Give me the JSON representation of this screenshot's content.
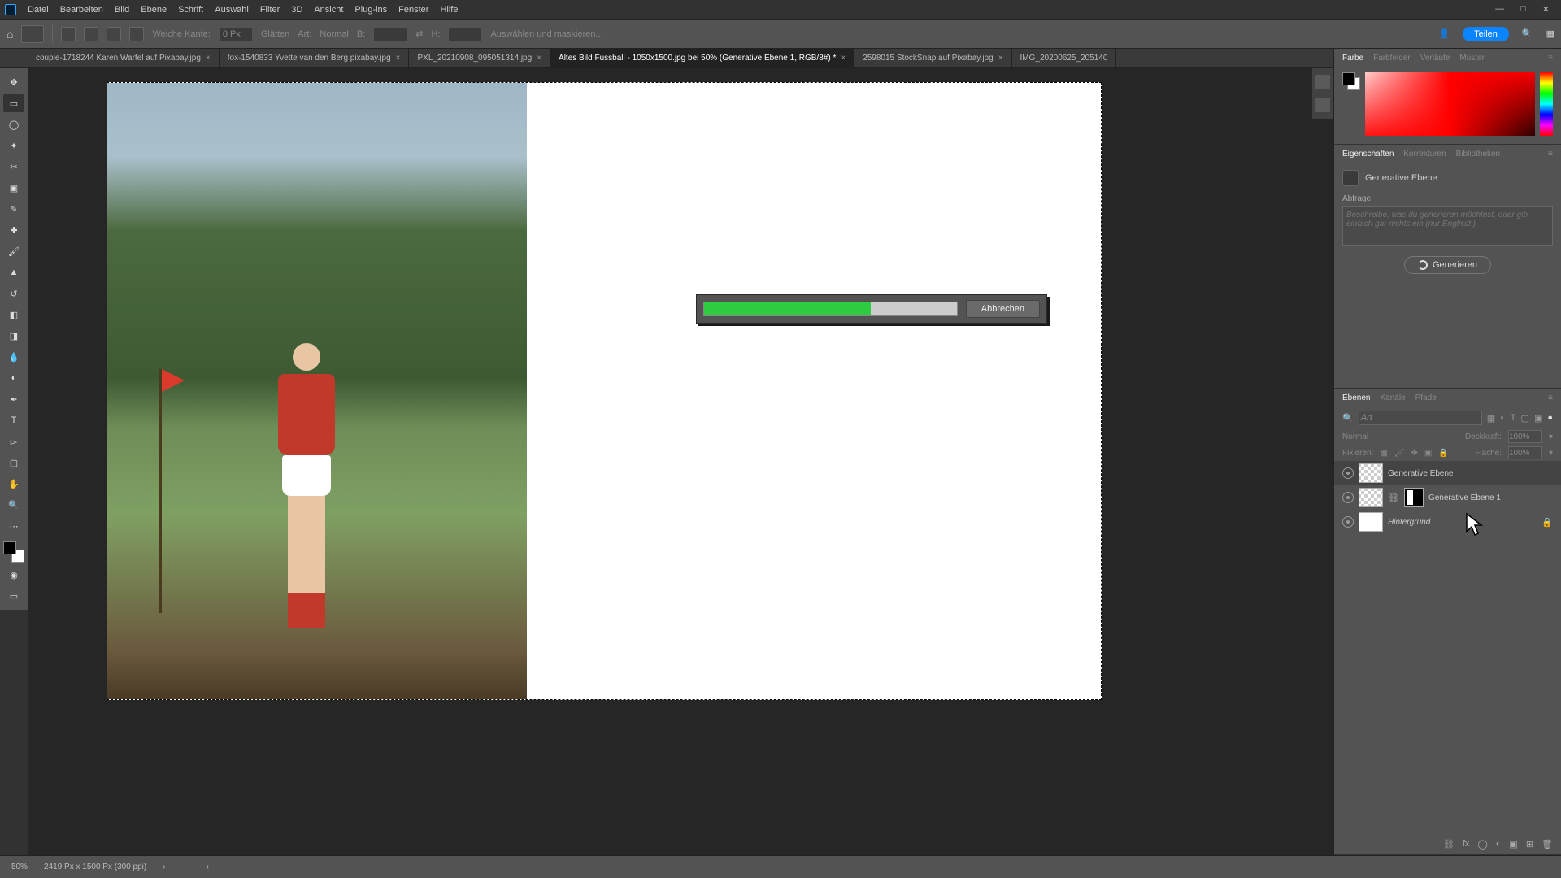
{
  "menubar": {
    "items": [
      "Datei",
      "Bearbeiten",
      "Bild",
      "Ebene",
      "Schrift",
      "Auswahl",
      "Filter",
      "3D",
      "Ansicht",
      "Plug-ins",
      "Fenster",
      "Hilfe"
    ]
  },
  "options_bar": {
    "feather_label": "Weiche Kante:",
    "feather_value": "0 Px",
    "antialias_label": "Glätten",
    "style_label": "Art:",
    "style_value": "Normal",
    "width_label": "B:",
    "height_label": "H:",
    "select_mask_label": "Auswählen und maskieren...",
    "share_label": "Teilen"
  },
  "tabs": [
    {
      "label": "couple-1718244 Karen Warfel auf Pixabay.jpg",
      "active": false
    },
    {
      "label": "fox-1540833 Yvette van den Berg pixabay.jpg",
      "active": false
    },
    {
      "label": "PXL_20210908_095051314.jpg",
      "active": false
    },
    {
      "label": "Altes Bild Fussball - 1050x1500.jpg bei 50% (Generative Ebene 1, RGB/8#) *",
      "active": true
    },
    {
      "label": "2598015 StockSnap auf Pixabay.jpg",
      "active": false
    },
    {
      "label": "IMG_20200625_205140",
      "active": false
    }
  ],
  "progress": {
    "percent": 66,
    "cancel_label": "Abbrechen"
  },
  "color_panel": {
    "tabs": [
      "Farbe",
      "Farbfelder",
      "Verläufe",
      "Muster"
    ],
    "active": 0
  },
  "props_panel": {
    "tabs": [
      "Eigenschaften",
      "Korrekturen",
      "Bibliotheken"
    ],
    "active": 0,
    "type_label": "Generative Ebene",
    "prompt_label": "Abfrage:",
    "prompt_placeholder": "Beschreibe, was du generieren möchtest, oder gib einfach gar nichts ein (nur Englisch).",
    "generate_label": "Generieren"
  },
  "layers_panel": {
    "tabs": [
      "Ebenen",
      "Kanäle",
      "Pfade"
    ],
    "active": 0,
    "search_placeholder": "Art",
    "blend_label": "Normal",
    "opacity_label": "Deckkraft:",
    "opacity_value": "100%",
    "lock_label": "Fixieren:",
    "fill_label": "Fläche:",
    "fill_value": "100%",
    "layers": [
      {
        "name": "Generative Ebene",
        "selected": true,
        "locked": false,
        "kind": "gen"
      },
      {
        "name": "Generative Ebene 1",
        "selected": false,
        "locked": false,
        "kind": "gen-mask"
      },
      {
        "name": "Hintergrund",
        "selected": false,
        "locked": true,
        "kind": "bg"
      }
    ]
  },
  "status": {
    "zoom": "50%",
    "doc_info": "2419 Px x 1500 Px (300 ppi)"
  }
}
